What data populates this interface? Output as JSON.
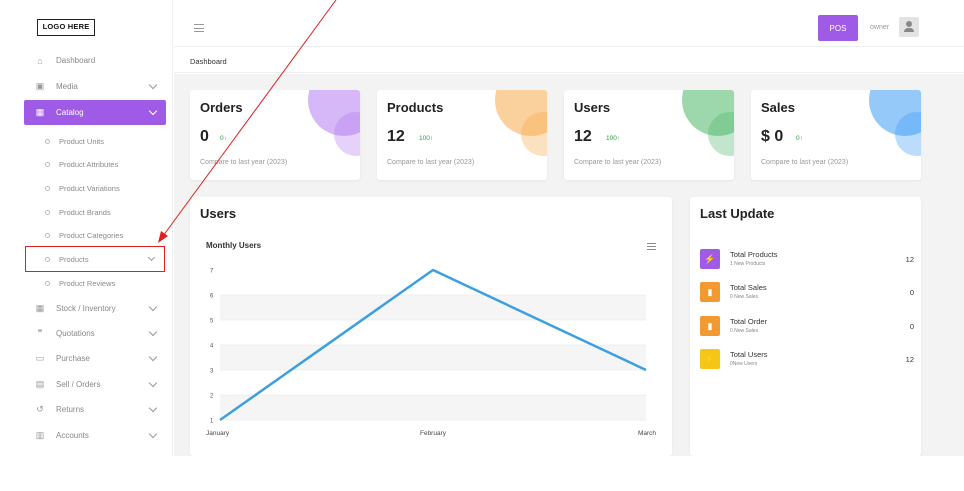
{
  "logo": "LOGO HERE",
  "sidebar": {
    "items": [
      {
        "label": "Dashboard",
        "icon": "home-icon",
        "glyph": "⌂",
        "expandable": false
      },
      {
        "label": "Media",
        "icon": "image-icon",
        "glyph": "▣",
        "expandable": true
      },
      {
        "label": "Catalog",
        "icon": "boxes-icon",
        "glyph": "▦",
        "expandable": true,
        "active": true
      }
    ],
    "catalog_children": [
      "Product Units",
      "Product Attributes",
      "Product Variations",
      "Product Brands",
      "Product Categories",
      "Products",
      "Product Reviews"
    ],
    "lower_items": [
      {
        "label": "Stock / Inventory",
        "icon": "boxes-icon",
        "glyph": "▦"
      },
      {
        "label": "Quotations",
        "icon": "quote-icon",
        "glyph": "❞"
      },
      {
        "label": "Purchase",
        "icon": "card-icon",
        "glyph": "▭"
      },
      {
        "label": "Sell / Orders",
        "icon": "clipboard-icon",
        "glyph": "▤"
      },
      {
        "label": "Returns",
        "icon": "undo-icon",
        "glyph": "↺"
      },
      {
        "label": "Accounts",
        "icon": "document-icon",
        "glyph": "▥"
      }
    ]
  },
  "topbar": {
    "pos_label": "POS",
    "user": "owner"
  },
  "breadcrumb": "Dashboard",
  "stats": [
    {
      "title": "Orders",
      "value": "0",
      "delta": "0↑",
      "compare": "Compare to last year (2023)",
      "color": "#b57cf0"
    },
    {
      "title": "Products",
      "value": "12",
      "delta": "100↑",
      "compare": "Compare to last year (2023)",
      "color": "#f5a94a"
    },
    {
      "title": "Users",
      "value": "12",
      "delta": "100↑",
      "compare": "Compare to last year (2023)",
      "color": "#4cb86a"
    },
    {
      "title": "Sales",
      "value": "$ 0",
      "delta": "0↑",
      "compare": "Compare to last year (2023)",
      "color": "#3d9cf5"
    }
  ],
  "users_panel": {
    "title": "Users",
    "chart_title": "Monthly Users"
  },
  "chart_data": {
    "type": "line",
    "title": "Monthly Users",
    "categories": [
      "January",
      "February",
      "March"
    ],
    "series": [
      {
        "values": [
          1,
          7,
          3
        ]
      }
    ],
    "ylim": [
      1,
      7
    ],
    "yticks": [
      "1",
      "2",
      "3",
      "4",
      "5",
      "6",
      "7"
    ],
    "grid": true,
    "line_color": "#3d9fe0"
  },
  "last_update": {
    "title": "Last Update",
    "rows": [
      {
        "name": "Total Products",
        "sub": "1 New Products",
        "value": "12",
        "color": "#a05be6",
        "icon": "bolt-icon",
        "glyph": "⚡"
      },
      {
        "name": "Total Sales",
        "sub": "0 New Sales",
        "value": "0",
        "color": "#f29a30",
        "icon": "bar-chart-icon",
        "glyph": "▮"
      },
      {
        "name": "Total Order",
        "sub": "0 New Sales",
        "value": "0",
        "color": "#f29a30",
        "icon": "bar-chart-icon",
        "glyph": "▮"
      },
      {
        "name": "Total Users",
        "sub": "0New Users",
        "value": "12",
        "color": "#f5c518",
        "icon": "bolt-icon",
        "glyph": "⚡"
      }
    ]
  },
  "annotation": {
    "color": "#e02020"
  }
}
